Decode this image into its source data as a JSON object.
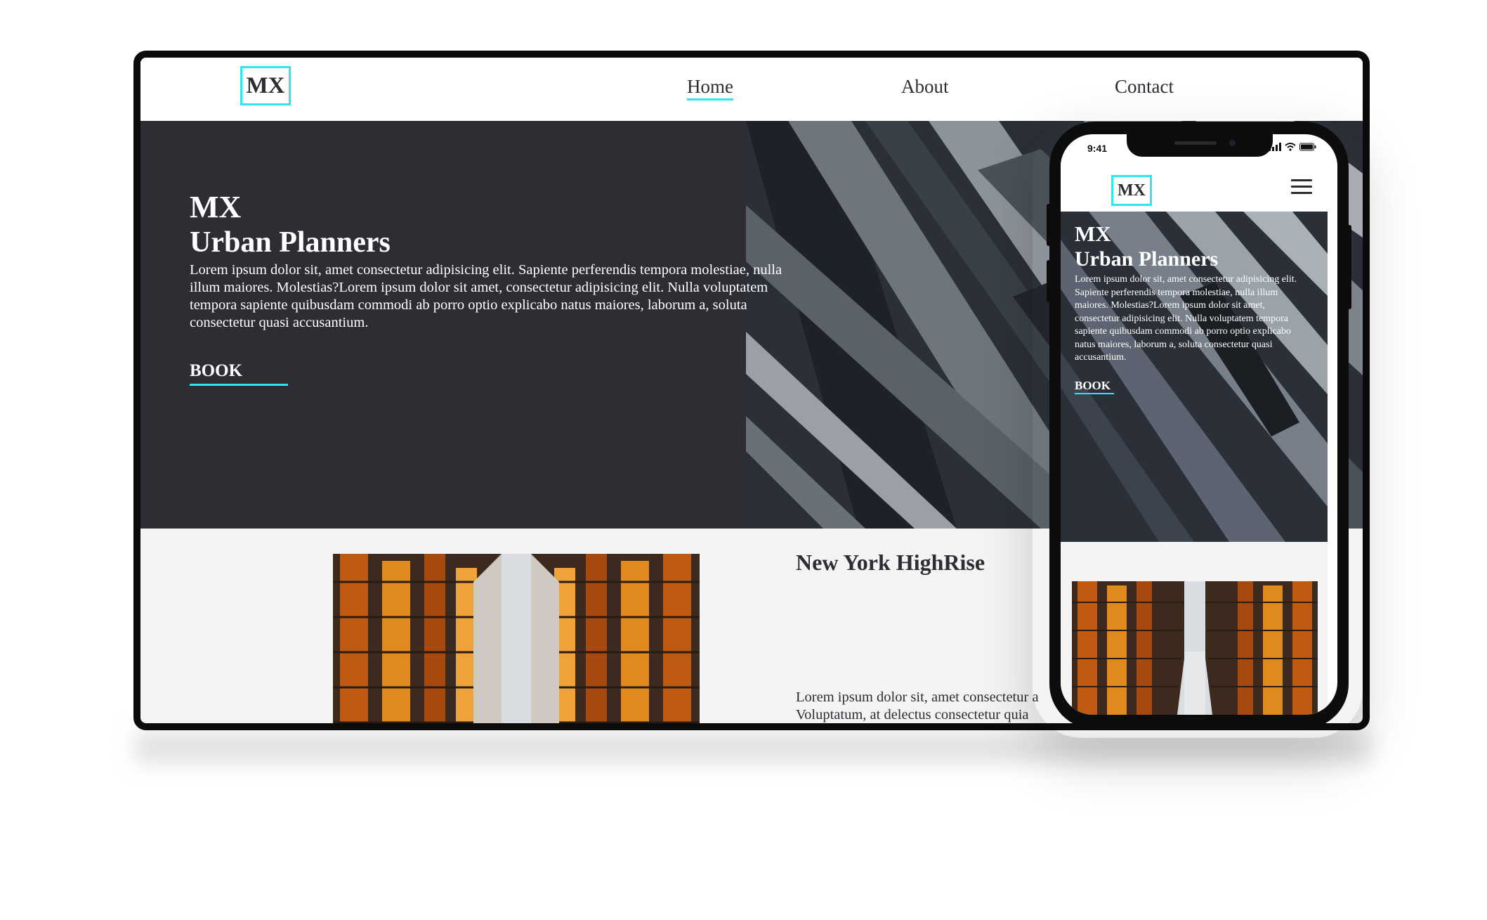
{
  "desktop": {
    "logo": "MX",
    "nav": [
      {
        "label": "Home",
        "active": true
      },
      {
        "label": "About",
        "active": false
      },
      {
        "label": "Contact",
        "active": false
      }
    ],
    "hero": {
      "brand": "MX",
      "title": "Urban Planners",
      "paragraph_lines": [
        "Lorem ipsum dolor sit, amet consectetur adipisicing elit. Sapiente perferendis tempora molestiae, nulla",
        "illum maiores. Molestias?Lorem ipsum dolor sit amet, consectetur adipisicing elit. Nulla voluptatem",
        "tempora sapiente quibusdam commodi ab porro optio explicabo natus maiores, laborum a, soluta",
        "consectetur quasi accusantium."
      ],
      "cta": "BOOK"
    },
    "card": {
      "title": "New York HighRise",
      "text_lines": [
        "Lorem ipsum dolor sit, amet consectetur a",
        "Voluptatum, at delectus consectetur quia"
      ]
    }
  },
  "phone": {
    "status_time": "9:41",
    "logo": "MX",
    "menu_icon": "hamburger-icon",
    "hero": {
      "brand": "MX",
      "title": "Urban Planners",
      "paragraph_lines": [
        "Lorem ipsum dolor sit, amet consectetur adipisicing elit.",
        "Sapiente perferendis tempora molestiae, nulla illum",
        "maiores. Molestias?Lorem ipsum dolor sit amet,",
        "consectetur adipisicing elit. Nulla voluptatem tempora",
        "sapiente quibusdam commodi ab porro optio explicabo",
        "natus maiores, laborum a, soluta consectetur quasi",
        "accusantium."
      ],
      "cta": "BOOK"
    }
  },
  "colors": {
    "accent": "#2ee6f0",
    "dark": "#2d2e33",
    "light_bg": "#f4f4f4"
  }
}
